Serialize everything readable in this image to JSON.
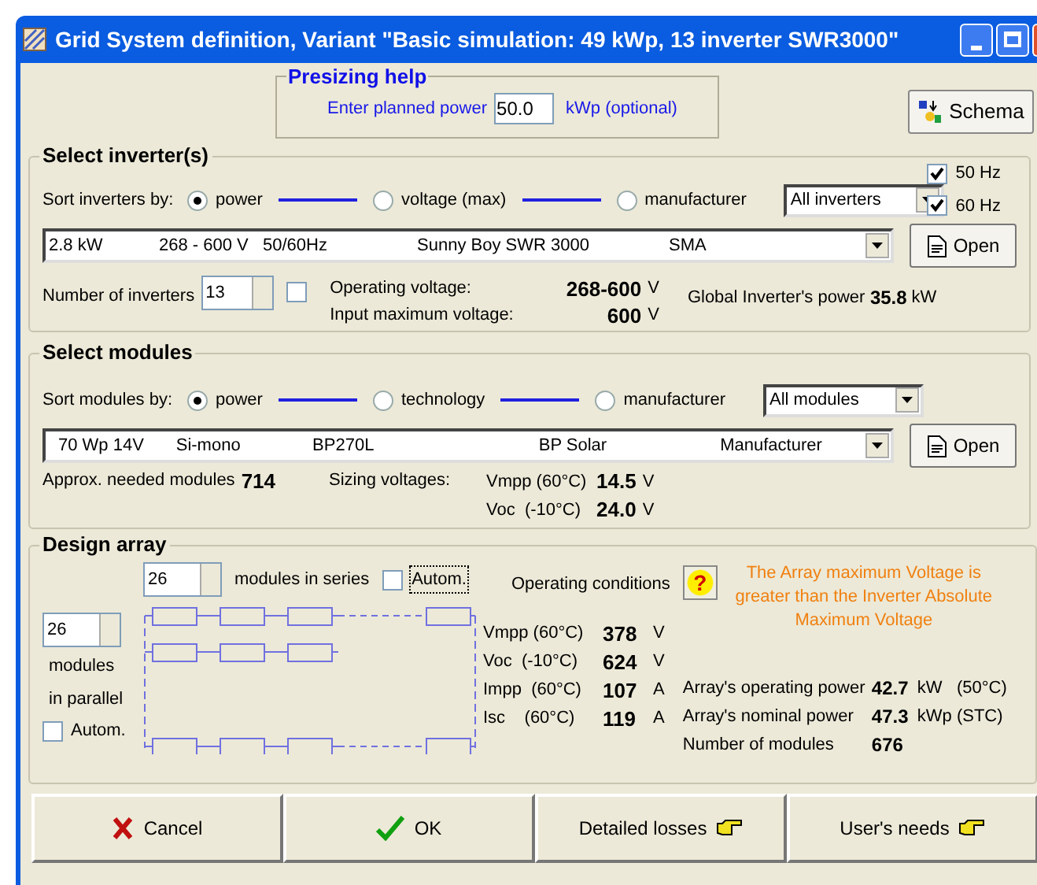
{
  "window": {
    "title": "Grid System definition, Variant  \"Basic simulation: 49 kWp, 13 inverter SWR3000\""
  },
  "presizing": {
    "title": "Presizing help",
    "label": "Enter planned power",
    "value": "50.0",
    "unit": "kWp (optional)"
  },
  "schema_button": "Schema",
  "inverters": {
    "title": "Select inverter(s)",
    "sort_label": "Sort inverters by:",
    "sort_options": [
      {
        "label": "power",
        "selected": true
      },
      {
        "label": "voltage (max)",
        "selected": false
      },
      {
        "label": "manufacturer",
        "selected": false
      }
    ],
    "filter": "All inverters",
    "frequencies": [
      {
        "label": "50 Hz",
        "checked": true
      },
      {
        "label": "60 Hz",
        "checked": true
      }
    ],
    "selection": [
      "2.8 kW",
      "268 - 600 V",
      "50/60Hz",
      "Sunny Boy SWR 3000",
      "SMA"
    ],
    "open_button": "Open",
    "count_label": "Number of inverters",
    "count": "13",
    "count_checked": false,
    "op_label": "Operating voltage:",
    "op_value": "268-600",
    "op_unit": "V",
    "max_label": "Input maximum  voltage:",
    "max_value": "600",
    "max_unit": "V",
    "global_label": "Global Inverter's power",
    "global_value": "35.8",
    "global_unit": "kW"
  },
  "modules": {
    "title": "Select modules",
    "sort_label": "Sort modules by:",
    "sort_options": [
      {
        "label": "power",
        "selected": true
      },
      {
        "label": "technology",
        "selected": false
      },
      {
        "label": "manufacturer",
        "selected": false
      }
    ],
    "filter": "All modules",
    "selection": [
      "70 Wp 14V",
      "Si-mono",
      "BP270L",
      "BP Solar",
      "Manufacturer"
    ],
    "open_button": "Open",
    "needed_label": "Approx. needed modules",
    "needed_value": "714",
    "sizing_label": "Sizing voltages:",
    "sizing": [
      {
        "label": "Vmpp (60°C)",
        "value": "14.5",
        "unit": "V"
      },
      {
        "label": "Voc  (-10°C)",
        "value": "24.0",
        "unit": "V"
      }
    ]
  },
  "design": {
    "title": "Design array",
    "series": "26",
    "series_label": "modules in series",
    "series_autom": {
      "label": "Autom.",
      "checked": false
    },
    "parallel": "26",
    "parallel_label": [
      "modules",
      "in parallel"
    ],
    "parallel_autom": {
      "label": "Autom.",
      "checked": false
    },
    "conditions_label": "Operating conditions",
    "help": "?",
    "warning": "The Array maximum Voltage is greater than the Inverter Absolute Maximum Voltage",
    "readings": [
      {
        "label": "Vmpp (60°C)",
        "value": "378",
        "unit": "V"
      },
      {
        "label": "Voc  (-10°C)",
        "value": "624",
        "unit": "V"
      },
      {
        "label": "Impp  (60°C)",
        "value": "107",
        "unit": "A"
      },
      {
        "label": "Isc    (60°C)",
        "value": "119",
        "unit": "A"
      }
    ],
    "summary": [
      {
        "label": "Array's operating power",
        "value": "42.7",
        "unit": "kW   (50°C)"
      },
      {
        "label": "Array's nominal power",
        "value": "47.3",
        "unit": "kWp (STC)"
      },
      {
        "label": "Number of modules",
        "value": "676"
      }
    ]
  },
  "buttons": [
    {
      "label": "Cancel",
      "kind": "cancel"
    },
    {
      "label": "OK",
      "kind": "ok"
    },
    {
      "label": "Detailed losses",
      "kind": "hand"
    },
    {
      "label": "User's needs",
      "kind": "hand"
    }
  ]
}
